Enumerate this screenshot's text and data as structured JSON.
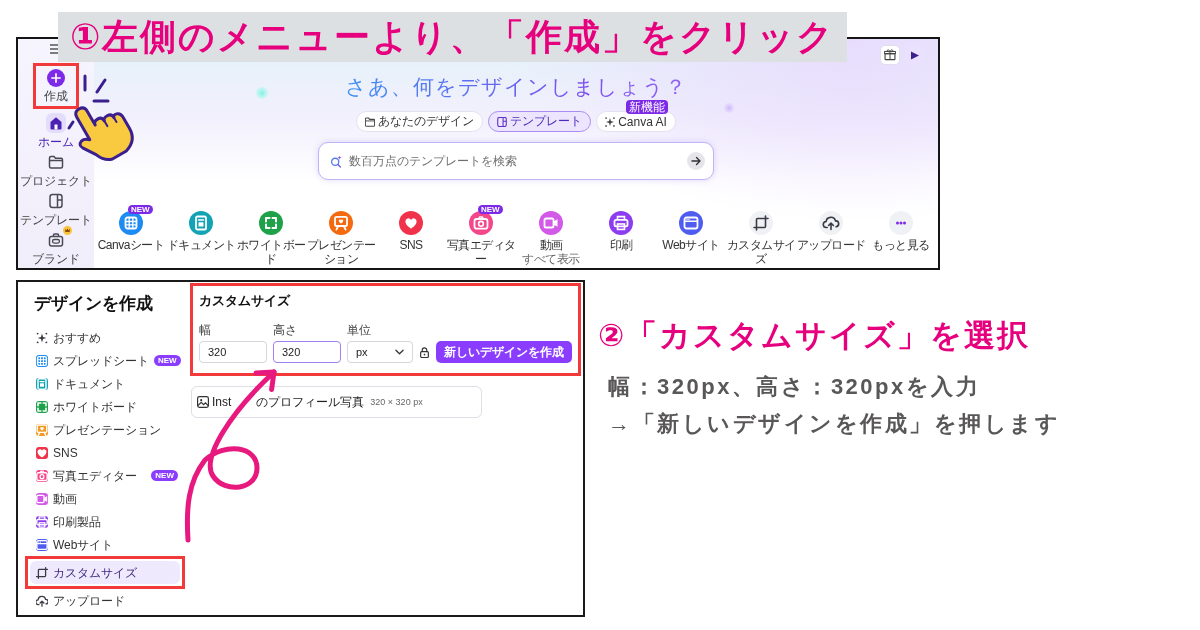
{
  "step1": {
    "title": "①左側のメニューより、「作成」をクリック"
  },
  "home_screen": {
    "sidebar": {
      "items": [
        {
          "kind": "create",
          "label": "作成",
          "selected": false,
          "highlighted": true,
          "crown_badge": false
        },
        {
          "kind": "nav",
          "label": "ホーム",
          "selected": true,
          "highlighted": false,
          "crown_badge": false
        },
        {
          "kind": "nav",
          "label": "プロジェクト",
          "selected": false,
          "highlighted": false,
          "crown_badge": false
        },
        {
          "kind": "nav",
          "label": "テンプレート",
          "selected": false,
          "highlighted": false,
          "crown_badge": false
        },
        {
          "kind": "nav",
          "label": "ブランド",
          "selected": false,
          "highlighted": false,
          "crown_badge": true
        }
      ]
    },
    "title": "さあ、何をデザインしましょう？",
    "tabs": [
      {
        "label": "あなたのデザイン",
        "selected": false
      },
      {
        "label": "テンプレート",
        "selected": true
      },
      {
        "label": "Canva AI",
        "selected": false,
        "badge": "新機能"
      }
    ],
    "search": {
      "placeholder": "数百万点のテンプレートを検索"
    },
    "categories": [
      {
        "label": "Canvaシート",
        "color": "#1d8bf1",
        "badge": "NEW"
      },
      {
        "label": "ドキュメント",
        "color": "#13a3b5"
      },
      {
        "label": "ホワイトボード",
        "color": "#1fa14a"
      },
      {
        "label": "プレゼンテーション",
        "color": "#f5690f"
      },
      {
        "label": "SNS",
        "color": "#f0334b"
      },
      {
        "label": "写真エディター",
        "color": "#f4468a",
        "badge": "NEW"
      },
      {
        "label": "動画",
        "color": "#d35ae8",
        "sublabel": "すべて表示"
      },
      {
        "label": "印刷",
        "color": "#8c3df0"
      },
      {
        "label": "Webサイト",
        "color": "#4f5cf0"
      },
      {
        "label": "カスタムサイズ",
        "color": "#f0f1f5"
      },
      {
        "label": "アップロード",
        "color": "#f0f1f5"
      },
      {
        "label": "もっと見る",
        "color": "#f0f1f5"
      }
    ]
  },
  "create_dialog": {
    "title": "デザインを作成",
    "menu": [
      {
        "label": "おすすめ",
        "selected": false,
        "highlighted": false
      },
      {
        "label": "スプレッドシート",
        "color": "#1d8bf1",
        "badge": "NEW",
        "selected": false,
        "highlighted": false
      },
      {
        "label": "ドキュメント",
        "color": "#13a3b5",
        "selected": false,
        "highlighted": false
      },
      {
        "label": "ホワイトボード",
        "color": "#1fa14a",
        "selected": false,
        "highlighted": false
      },
      {
        "label": "プレゼンテーション",
        "color": "#f39a26",
        "selected": false,
        "highlighted": false
      },
      {
        "label": "SNS",
        "color": "#f0334b",
        "selected": false,
        "highlighted": false
      },
      {
        "label": "写真エディター",
        "color": "#f4468a",
        "badge": "NEW",
        "selected": false,
        "highlighted": false
      },
      {
        "label": "動画",
        "color": "#d35ae8",
        "selected": false,
        "highlighted": false
      },
      {
        "label": "印刷製品",
        "color": "#8c3df0",
        "selected": false,
        "highlighted": false
      },
      {
        "label": "Webサイト",
        "color": "#4f5cf0",
        "selected": false,
        "highlighted": false
      },
      {
        "label": "カスタムサイズ",
        "selected": true,
        "highlighted": true
      },
      {
        "label": "アップロード",
        "selected": false,
        "highlighted": false
      }
    ],
    "custom_size": {
      "title": "カスタムサイズ",
      "highlighted": true,
      "width": {
        "label": "幅",
        "value": "320",
        "focused": false
      },
      "height": {
        "label": "高さ",
        "value": "320",
        "focused": true
      },
      "unit": {
        "label": "単位",
        "value": "px"
      },
      "create_button": "新しいデザインを作成"
    },
    "suggestion": {
      "name_start": "Inst",
      "name_end": "のプロフィール写真",
      "size": "320 × 320 px"
    }
  },
  "step2": {
    "title": "②「カスタムサイズ」を選択",
    "lines": [
      "幅：320px、高さ：320pxを入力",
      "→「新しいデザインを作成」を押します"
    ]
  }
}
